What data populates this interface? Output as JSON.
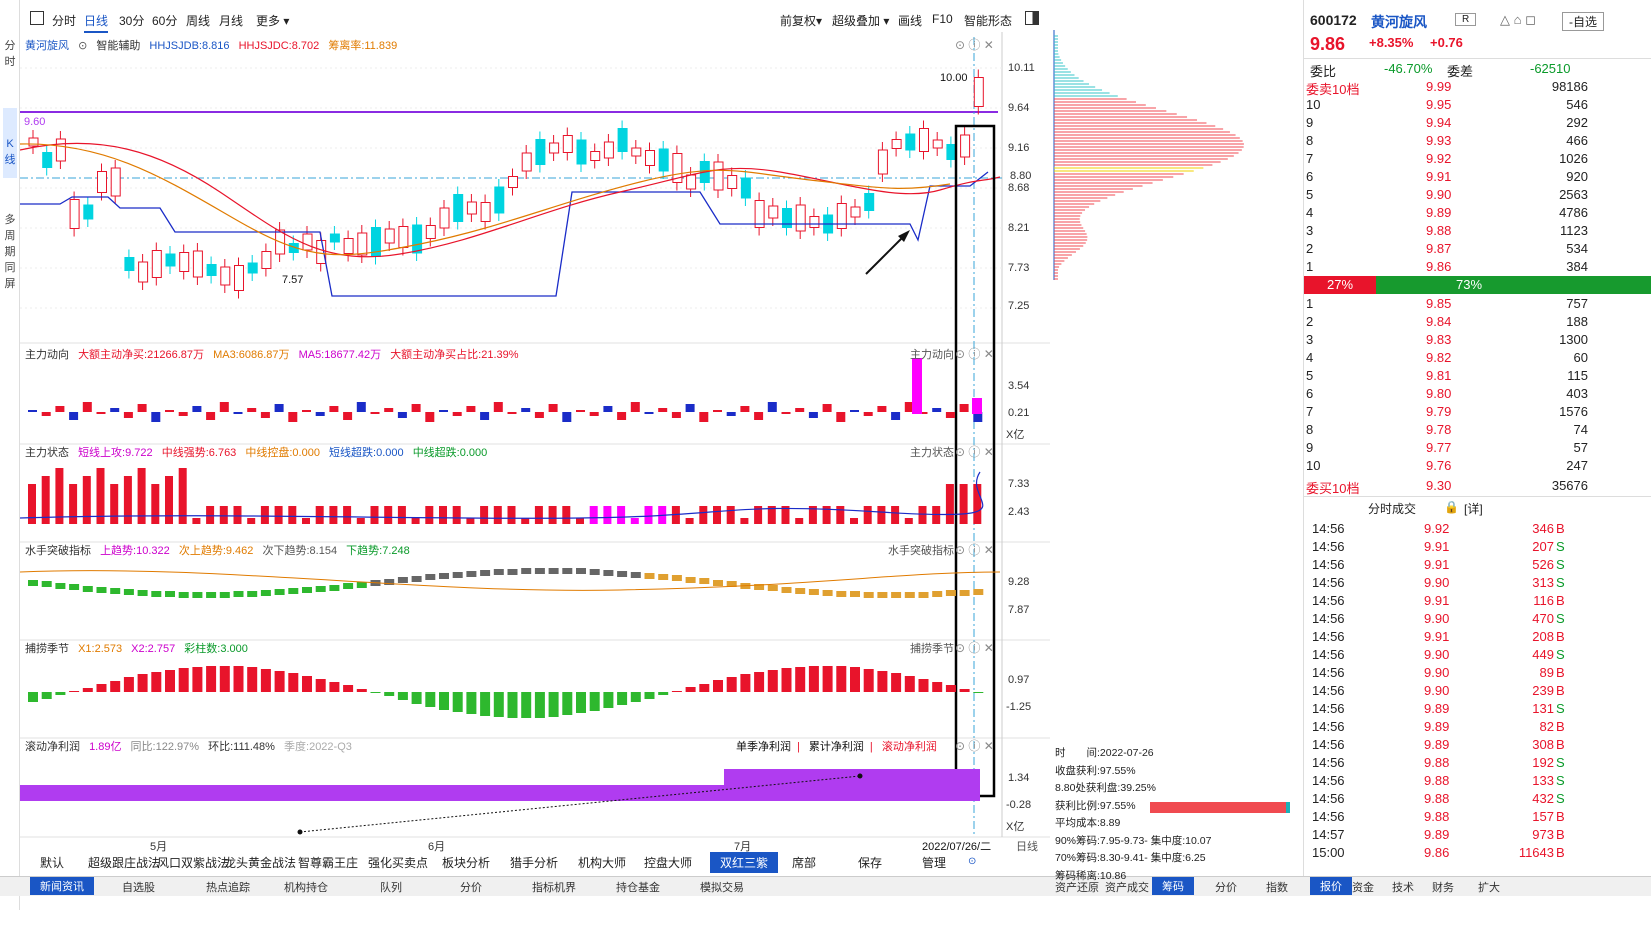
{
  "left_sidebar": {
    "items": [
      {
        "label": "分时"
      },
      {
        "label": "K线",
        "selected": true
      },
      {
        "label": "多周期同屏"
      }
    ]
  },
  "toolbar": {
    "tabs": [
      "分时",
      "日线",
      "30分",
      "60分",
      "周线",
      "月线",
      "更多"
    ],
    "active": "日线",
    "right": [
      "前复权",
      "超级叠加",
      "画线",
      "F10",
      "智能形态"
    ]
  },
  "main_chart": {
    "stock_label": "黄河旋风",
    "ai_label": "智能辅助",
    "indicators": [
      {
        "text": "HHJSJDB:8.816",
        "color": "#1a56c5"
      },
      {
        "text": "HHJSJDC:8.702",
        "color": "#e8142b"
      },
      {
        "text": "筹离率:11.839",
        "color": "#e07b00"
      }
    ],
    "price_ticks": [
      "10.11",
      "9.64",
      "9.16",
      "8.80",
      "8.68",
      "8.21",
      "7.73",
      "7.25"
    ],
    "high_label": "10.00",
    "low_label": "7.57",
    "left_price": "9.60",
    "month_labels": [
      "5月",
      "6月",
      "7月"
    ],
    "date_label": "2022/07/26/二",
    "axis_right_label": "日线"
  },
  "panels": [
    {
      "title": "主力动向",
      "right_title": "主力动向",
      "items": [
        {
          "t": "大额主动净买:21266.87万",
          "c": "#e8142b"
        },
        {
          "t": "MA3:6086.87万",
          "c": "#e07b00"
        },
        {
          "t": "MA5:18677.42万",
          "c": "#cc00cc"
        },
        {
          "t": "大额主动净买占比:21.39%",
          "c": "#e8142b"
        }
      ],
      "ticks": [
        "3.54",
        "0.21",
        "X亿"
      ]
    },
    {
      "title": "主力状态",
      "right_title": "主力状态",
      "items": [
        {
          "t": "短线上攻:9.722",
          "c": "#cc00cc"
        },
        {
          "t": "中线强势:6.763",
          "c": "#e8142b"
        },
        {
          "t": "中线控盘:0.000",
          "c": "#e07b00"
        },
        {
          "t": "短线超跌:0.000",
          "c": "#1a56c5"
        },
        {
          "t": "中线超跌:0.000",
          "c": "#0a9a2a"
        }
      ],
      "ticks": [
        "7.33",
        "2.43"
      ]
    },
    {
      "title": "水手突破指标",
      "right_title": "水手突破指标",
      "items": [
        {
          "t": "上趋势:10.322",
          "c": "#cc00cc"
        },
        {
          "t": "次上趋势:9.462",
          "c": "#e07b00"
        },
        {
          "t": "次下趋势:8.154",
          "c": "#555"
        },
        {
          "t": "下趋势:7.248",
          "c": "#0a9a2a"
        }
      ],
      "ticks": [
        "9.28",
        "7.87"
      ]
    },
    {
      "title": "捕捞季节",
      "right_title": "捕捞季节",
      "items": [
        {
          "t": "X1:2.573",
          "c": "#e07b00"
        },
        {
          "t": "X2:2.757",
          "c": "#cc00cc"
        },
        {
          "t": "彩柱数:3.000",
          "c": "#0a9a2a"
        }
      ],
      "ticks": [
        "0.97",
        "-1.25"
      ]
    },
    {
      "title": "滚动净利润",
      "right_title": "",
      "items": [
        {
          "t": "1.89亿",
          "c": "#cc00cc"
        },
        {
          "t": "同比:122.97%",
          "c": "#888"
        },
        {
          "t": "环比:111.48%",
          "c": "#333"
        },
        {
          "t": "季度:2022-Q3",
          "c": "#aaa"
        }
      ],
      "ticks": [
        "1.34",
        "-0.28",
        "X亿"
      ],
      "legend": [
        "单季净利润",
        "累计净利润",
        "滚动净利润"
      ]
    }
  ],
  "bottom_tabs": [
    "默认",
    "超级跟庄战法",
    "风口双紫战法",
    "龙头黄金战法",
    "智尊霸王庄",
    "强化买卖点",
    "板块分析",
    "猎手分析",
    "机构大师",
    "控盘大师",
    "双红三紫",
    "席部",
    "保存",
    "管理"
  ],
  "bottom_active": "双红三紫",
  "footer_tabs": [
    "新闻资讯",
    "自选股",
    "热点追踪",
    "机构持仓",
    "队列",
    "分价",
    "指标机界",
    "持仓基金",
    "模拟交易"
  ],
  "footer_right_tabs": [
    "资产还原",
    "资产成交",
    "筹码",
    "分价",
    "指数"
  ],
  "footer_right_active": "筹码",
  "footer_far_tabs": [
    "报价",
    "资金",
    "技术",
    "财务",
    "扩大"
  ],
  "chip": {
    "lines": [
      "时　　间:2022-07-26",
      "收盘获利:97.55%",
      "8.80处获利盘:39.25%",
      "获利比例:97.55%",
      "平均成本:8.89",
      "90%筹码:7.95-9.73- 集中度:10.07",
      "70%筹码:8.30-9.41- 集中度:6.25",
      "筹码稀离:10.86"
    ]
  },
  "quote": {
    "code": "600172",
    "name": "黄河旋风",
    "r_badge": "R",
    "self_btn": "自选",
    "price": "9.86",
    "pct": "+8.35%",
    "chg": "+0.76",
    "ratio_label": "委比",
    "ratio": "-46.70%",
    "diff_label": "委差",
    "diff": "-62510",
    "sell_header": "委卖10档",
    "sell_header_price": "9.99",
    "sell_header_vol": "98186",
    "sells": [
      [
        "10",
        "9.95",
        "546"
      ],
      [
        "9",
        "9.94",
        "292"
      ],
      [
        "8",
        "9.93",
        "466"
      ],
      [
        "7",
        "9.92",
        "1026"
      ],
      [
        "6",
        "9.91",
        "920"
      ],
      [
        "5",
        "9.90",
        "2563"
      ],
      [
        "4",
        "9.89",
        "4786"
      ],
      [
        "3",
        "9.88",
        "1123"
      ],
      [
        "2",
        "9.87",
        "534"
      ],
      [
        "1",
        "9.86",
        "384"
      ]
    ],
    "bar_left": "27%",
    "bar_right": "73%",
    "buys": [
      [
        "1",
        "9.85",
        "757"
      ],
      [
        "2",
        "9.84",
        "188"
      ],
      [
        "3",
        "9.83",
        "1300"
      ],
      [
        "4",
        "9.82",
        "60"
      ],
      [
        "5",
        "9.81",
        "115"
      ],
      [
        "6",
        "9.80",
        "403"
      ],
      [
        "7",
        "9.79",
        "1576"
      ],
      [
        "8",
        "9.78",
        "74"
      ],
      [
        "9",
        "9.77",
        "57"
      ],
      [
        "10",
        "9.76",
        "247"
      ]
    ],
    "buy_header": "委买10档",
    "buy_header_price": "9.30",
    "buy_header_vol": "35676",
    "ticks_title": "分时成交",
    "ticks_detail": "[详]",
    "trades": [
      [
        "14:56",
        "9.92",
        "346",
        "B"
      ],
      [
        "14:56",
        "9.91",
        "207",
        "S"
      ],
      [
        "14:56",
        "9.91",
        "526",
        "S"
      ],
      [
        "14:56",
        "9.90",
        "313",
        "S"
      ],
      [
        "14:56",
        "9.91",
        "116",
        "B"
      ],
      [
        "14:56",
        "9.90",
        "470",
        "S"
      ],
      [
        "14:56",
        "9.91",
        "208",
        "B"
      ],
      [
        "14:56",
        "9.90",
        "449",
        "S"
      ],
      [
        "14:56",
        "9.90",
        "89",
        "B"
      ],
      [
        "14:56",
        "9.90",
        "239",
        "B"
      ],
      [
        "14:56",
        "9.89",
        "131",
        "S"
      ],
      [
        "14:56",
        "9.89",
        "82",
        "B"
      ],
      [
        "14:56",
        "9.89",
        "308",
        "B"
      ],
      [
        "14:56",
        "9.88",
        "192",
        "S"
      ],
      [
        "14:56",
        "9.88",
        "133",
        "S"
      ],
      [
        "14:56",
        "9.88",
        "432",
        "S"
      ],
      [
        "14:56",
        "9.88",
        "157",
        "B"
      ],
      [
        "14:57",
        "9.89",
        "973",
        "B"
      ],
      [
        "15:00",
        "9.86",
        "11643",
        "B"
      ]
    ]
  },
  "colors": {
    "up": "#e8142b",
    "down": "#00d4e0",
    "accent": "#1a56c5",
    "purple": "#b03cf0"
  }
}
